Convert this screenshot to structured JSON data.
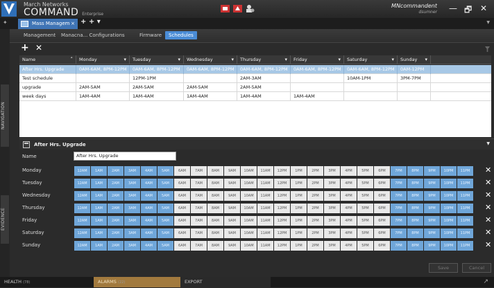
{
  "app": {
    "company": "March Networks",
    "product": "COMMAND",
    "edition": "Enterprise",
    "user_name": "MNcommandent",
    "user_role": "dsumner",
    "minimize": "—",
    "restore": "🗗",
    "close": "✕"
  },
  "doc_tab": {
    "label": "Mass Managem",
    "close": "×",
    "add": "+ + ▾"
  },
  "nav_labels": {
    "navigation": "NAVIGATION",
    "evidence": "EVIDENCE"
  },
  "sub_tabs": [
    "Management",
    "Manacna... Configurations",
    "Firmware",
    "Schedules"
  ],
  "toolbar": {
    "add": "+",
    "delete": "✕"
  },
  "columns": [
    "Name",
    "Monday",
    "Tuesday",
    "Wednesday",
    "Thursday",
    "Friday",
    "Saturday",
    "Sunday"
  ],
  "schedules": [
    {
      "name": "After Hrs. Upgrade",
      "days": [
        "0AM-6AM, 8PM-12PM",
        "0AM-6AM, 8PM-12PM",
        "0AM-6AM, 8PM-12PM",
        "0AM-6AM, 8PM-12PM",
        "0AM-6AM, 8PM-12PM",
        "0AM-6AM, 8PM-12PM",
        "0AM-12PM"
      ]
    },
    {
      "name": "Test schedule",
      "days": [
        "",
        "12PM-1PM",
        "",
        "2AM-3AM",
        "",
        "10AM-1PM",
        "3PM-7PM"
      ]
    },
    {
      "name": "upgrade",
      "days": [
        "2AM-5AM",
        "2AM-5AM",
        "2AM-5AM",
        "2AM-5AM",
        "",
        "",
        ""
      ]
    },
    {
      "name": "week days",
      "days": [
        "1AM-4AM",
        "1AM-4AM",
        "1AM-4AM",
        "1AM-4AM",
        "1AM-4AM",
        "",
        ""
      ]
    }
  ],
  "detail": {
    "title": "After Hrs. Upgrade",
    "name_label": "Name",
    "name_value": "After Hrs. Upgrade",
    "days": [
      "Monday",
      "Tuesday",
      "Wednesday",
      "Thursday",
      "Friday",
      "Saturday",
      "Sunday"
    ],
    "hours": [
      "12AM",
      "1AM",
      "2AM",
      "3AM",
      "4AM",
      "5AM",
      "6AM",
      "7AM",
      "8AM",
      "9AM",
      "10AM",
      "11AM",
      "12PM",
      "1PM",
      "2PM",
      "3PM",
      "4PM",
      "5PM",
      "6PM",
      "7PM",
      "8PM",
      "9PM",
      "10PM",
      "11PM"
    ],
    "active_hours": [
      0,
      1,
      2,
      3,
      4,
      5,
      19,
      20,
      21,
      22,
      23
    ],
    "remove": "✕",
    "save": "Save",
    "cancel": "Cancel"
  },
  "status": {
    "health": "HEALTH",
    "health_count": "(78)",
    "alarms": "ALARMS",
    "alarms_count": "(22)",
    "export": "EXPORT",
    "expand": "↗"
  },
  "colors": {
    "accent": "#4a8cd6",
    "selected_row": "#a7c8e6",
    "active_hour": "#6fa6d9",
    "alarms": "#a27a3e"
  }
}
